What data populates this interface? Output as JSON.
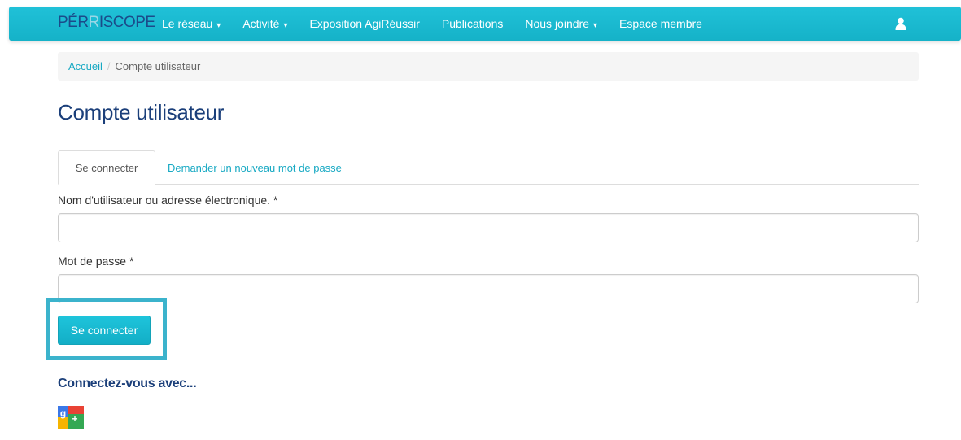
{
  "navbar": {
    "logo": {
      "part1": "PÉR",
      "accent": "R",
      "part2": "ISCOPE"
    },
    "items": [
      {
        "label": "Le réseau",
        "caret": true
      },
      {
        "label": "Activité",
        "caret": true
      },
      {
        "label": "Exposition AgiRéussir",
        "caret": false
      },
      {
        "label": "Publications",
        "caret": false
      },
      {
        "label": "Nous joindre",
        "caret": true
      },
      {
        "label": "Espace membre",
        "caret": false
      }
    ],
    "user_icon": "user-icon",
    "colors": {
      "background": "#1bbad0",
      "text": "#ffffff"
    }
  },
  "breadcrumb": {
    "home": "Accueil",
    "separator": "/",
    "current": "Compte utilisateur"
  },
  "page": {
    "title": "Compte utilisateur"
  },
  "tabs": {
    "active": "Se connecter",
    "other": "Demander un nouveau mot de passe"
  },
  "form": {
    "username_label": "Nom d'utilisateur ou adresse électronique. *",
    "username_value": "",
    "password_label": "Mot de passe *",
    "password_value": "",
    "submit_label": "Se connecter"
  },
  "social": {
    "heading": "Connectez-vous avec...",
    "provider_icon": "google-icon"
  },
  "colors": {
    "accent": "#17a9c3",
    "title": "#1b3f7a",
    "highlight": "#3bb3cc"
  }
}
